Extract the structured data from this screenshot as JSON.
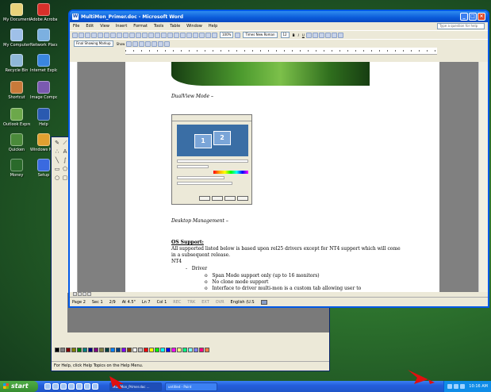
{
  "desktop": {
    "icons": [
      {
        "label": "My Documents",
        "color": "#e8d27a"
      },
      {
        "label": "Adobe Acrobat",
        "color": "#d9302a"
      },
      {
        "label": "My Computer",
        "color": "#9fc0e8"
      },
      {
        "label": "Network Places",
        "color": "#7cb0e0"
      },
      {
        "label": "Recycle Bin",
        "color": "#8fb8d8"
      },
      {
        "label": "Internet Explorer",
        "color": "#3a86e0"
      },
      {
        "label": "Shortcut",
        "color": "#c97a3a"
      },
      {
        "label": "Image Composer",
        "color": "#7a5ab0"
      },
      {
        "label": "Outlook Express",
        "color": "#6ca84a"
      },
      {
        "label": "Help",
        "color": "#2a5ab0"
      },
      {
        "label": "Quicken",
        "color": "#4a8a3a"
      },
      {
        "label": "Windows Media",
        "color": "#e0a030"
      },
      {
        "label": "Money",
        "color": "#2a6a2a"
      },
      {
        "label": "Setup",
        "color": "#3a6ae0"
      }
    ]
  },
  "word": {
    "title": "MultiMon_Primer.doc - Microsoft Word",
    "menu": [
      "File",
      "Edit",
      "View",
      "Insert",
      "Format",
      "Tools",
      "Table",
      "Window",
      "Help"
    ],
    "help_placeholder": "Type a question for help",
    "zoom": "100%",
    "font": "Times New Roman",
    "font_size": "12",
    "markup_select": "Final Showing Markup",
    "show_label": "Show",
    "doc": {
      "dualview_heading": "DualView Mode –",
      "desktop_mgmt_heading": "Desktop Management –",
      "os_support_heading": "OS Support:",
      "os_support_body": "All supported listed below is based upon rel25 drivers except for NT4 support which will come in a subsequent release.",
      "nt4": "NT4",
      "driver": "Driver",
      "bullets": [
        "Span Mode support only (up to 16 monitors)",
        "No clone mode support",
        "Interface to driver multi-mon is a custom tab allowing user to"
      ]
    },
    "dialog_monitors": [
      "1",
      "2"
    ],
    "status": {
      "page": "Page 2",
      "sec": "Sec 1",
      "pages": "2/9",
      "at": "At 4.5\"",
      "ln": "Ln 7",
      "col": "Col 1",
      "rec": "REC",
      "trk": "TRK",
      "ext": "EXT",
      "ovr": "OVR",
      "lang": "English (U.S"
    }
  },
  "paint": {
    "status": "For Help, click Help Topics on the Help Menu.",
    "palette": [
      "#000000",
      "#808080",
      "#800000",
      "#808000",
      "#008000",
      "#008080",
      "#000080",
      "#800080",
      "#808040",
      "#004040",
      "#0080ff",
      "#004080",
      "#8000ff",
      "#804000",
      "#ffffff",
      "#c0c0c0",
      "#ff0000",
      "#ffff00",
      "#00ff00",
      "#00ffff",
      "#0000ff",
      "#ff00ff",
      "#ffff80",
      "#00ff80",
      "#80ffff",
      "#8080ff",
      "#ff0080",
      "#ff8040"
    ]
  },
  "taskbar": {
    "start": "start",
    "tasks": [
      "MultiMon_Primer.doc ...",
      "untitled - Paint"
    ],
    "clock": "10:16 AM"
  }
}
